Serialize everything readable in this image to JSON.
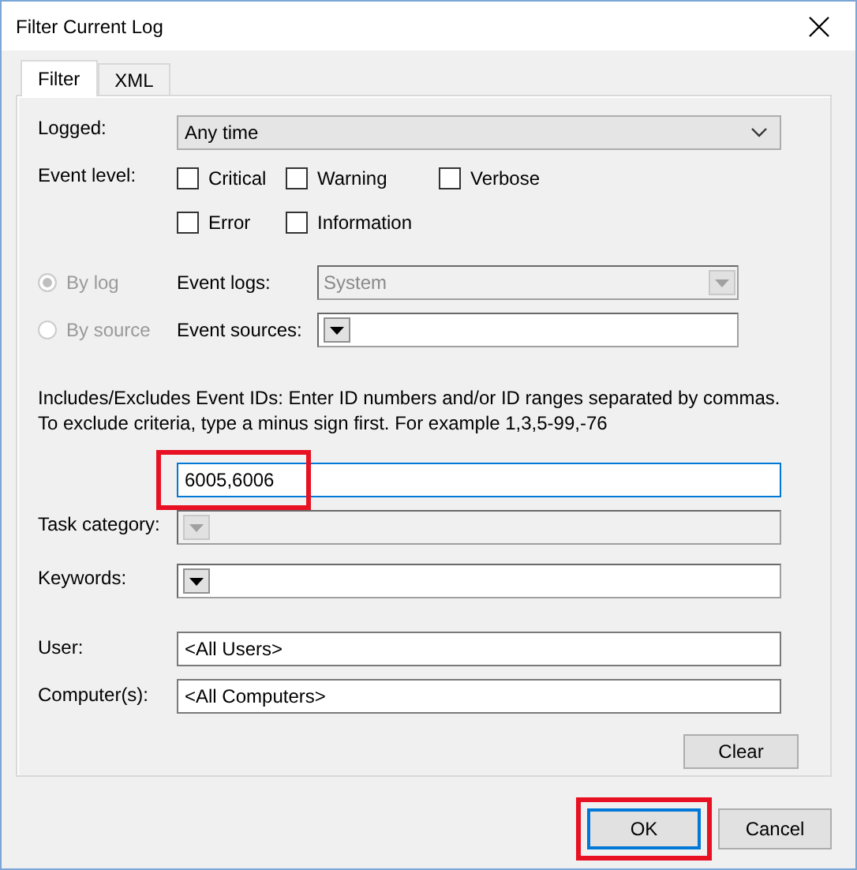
{
  "window": {
    "title": "Filter Current Log"
  },
  "tabs": [
    {
      "label": "Filter",
      "selected": true
    },
    {
      "label": "XML",
      "selected": false
    }
  ],
  "logged": {
    "label": "Logged:",
    "value": "Any time"
  },
  "event_level": {
    "label": "Event level:",
    "options": [
      {
        "label": "Critical",
        "checked": false
      },
      {
        "label": "Warning",
        "checked": false
      },
      {
        "label": "Verbose",
        "checked": false
      },
      {
        "label": "Error",
        "checked": false
      },
      {
        "label": "Information",
        "checked": false
      }
    ]
  },
  "source_mode": [
    {
      "label": "By log",
      "selected": true,
      "disabled": true,
      "field_label": "Event logs:",
      "value": "System",
      "field_disabled": true
    },
    {
      "label": "By source",
      "selected": false,
      "disabled": true,
      "field_label": "Event sources:",
      "field_disabled": false
    }
  ],
  "event_ids": {
    "description": "Includes/Excludes Event IDs: Enter ID numbers and/or ID ranges separated by commas. To exclude criteria, type a minus sign first. For example 1,3,5-99,-76",
    "value": "6005,6006",
    "highlighted": true
  },
  "task_category": {
    "label": "Task category:",
    "disabled": true
  },
  "keywords": {
    "label": "Keywords:",
    "disabled": false
  },
  "user": {
    "label": "User:",
    "value": "<All Users>"
  },
  "computer": {
    "label": "Computer(s):",
    "value": "<All Computers>"
  },
  "clear_button": "Clear",
  "buttons": [
    {
      "label": "OK",
      "default": true,
      "highlighted": true
    },
    {
      "label": "Cancel",
      "default": false,
      "highlighted": false
    }
  ]
}
